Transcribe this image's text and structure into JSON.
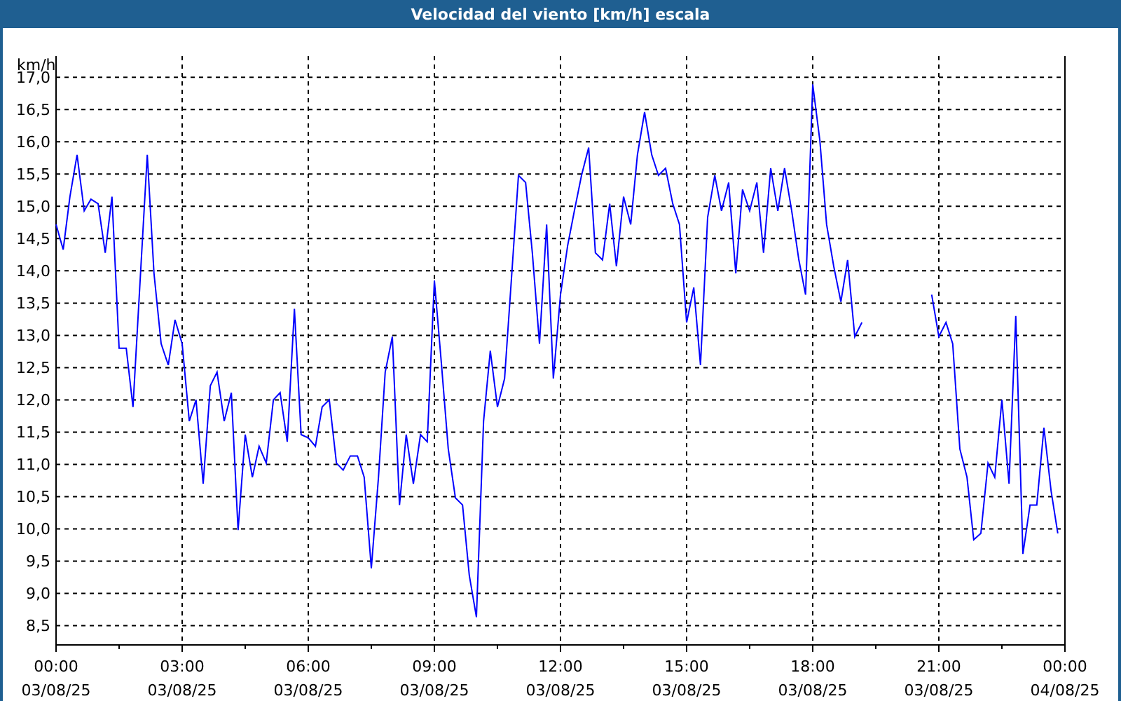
{
  "window": {
    "title": "Velocidad del viento [km/h] escala"
  },
  "chart": {
    "xtick_dates": [
      "03/08/25",
      "03/08/25",
      "03/08/25",
      "03/08/25",
      "03/08/25",
      "03/08/25",
      "03/08/25",
      "03/08/25",
      "04/08/25"
    ],
    "chart_data": {
      "type": "line",
      "ylabel": "km/h",
      "grid": true,
      "xlim": [
        0,
        24
      ],
      "ylim": [
        8.2,
        17.33
      ],
      "xticks": [
        {
          "value": 0,
          "label": "00:00"
        },
        {
          "value": 3,
          "label": "03:00"
        },
        {
          "value": 6,
          "label": "06:00"
        },
        {
          "value": 9,
          "label": "09:00"
        },
        {
          "value": 12,
          "label": "12:00"
        },
        {
          "value": 15,
          "label": "15:00"
        },
        {
          "value": 18,
          "label": "18:00"
        },
        {
          "value": 21,
          "label": "21:00"
        },
        {
          "value": 24,
          "label": "00:00"
        }
      ],
      "yticks": [
        {
          "value": 8.5,
          "label": "8,5"
        },
        {
          "value": 9,
          "label": "9,0"
        },
        {
          "value": 9.5,
          "label": "9,5"
        },
        {
          "value": 10,
          "label": "10,0"
        },
        {
          "value": 10.5,
          "label": "10,5"
        },
        {
          "value": 11,
          "label": "11,0"
        },
        {
          "value": 11.5,
          "label": "11,5"
        },
        {
          "value": 12,
          "label": "12,0"
        },
        {
          "value": 12.5,
          "label": "12,5"
        },
        {
          "value": 13,
          "label": "13,0"
        },
        {
          "value": 13.5,
          "label": "13,5"
        },
        {
          "value": 14,
          "label": "14,0"
        },
        {
          "value": 14.5,
          "label": "14,5"
        },
        {
          "value": 15,
          "label": "15,0"
        },
        {
          "value": 15.5,
          "label": "15,5"
        },
        {
          "value": 16,
          "label": "16,0"
        },
        {
          "value": 16.5,
          "label": "16,5"
        },
        {
          "value": 17,
          "label": "17,0"
        }
      ],
      "x": [
        0,
        0.17,
        0.33,
        0.5,
        0.67,
        0.83,
        1,
        1.17,
        1.33,
        1.5,
        1.67,
        1.83,
        2,
        2.17,
        2.33,
        2.5,
        2.67,
        2.83,
        3,
        3.17,
        3.33,
        3.5,
        3.67,
        3.83,
        4,
        4.17,
        4.33,
        4.5,
        4.67,
        4.83,
        5,
        5.17,
        5.33,
        5.5,
        5.67,
        5.83,
        6,
        6.17,
        6.33,
        6.5,
        6.67,
        6.83,
        7,
        7.17,
        7.33,
        7.5,
        7.67,
        7.83,
        8,
        8.17,
        8.33,
        8.5,
        8.67,
        8.83,
        9,
        9.17,
        9.33,
        9.5,
        9.67,
        9.83,
        10,
        10.17,
        10.33,
        10.5,
        10.67,
        10.83,
        11,
        11.17,
        11.33,
        11.5,
        11.67,
        11.83,
        12,
        12.17,
        12.33,
        12.5,
        12.67,
        12.83,
        13,
        13.17,
        13.33,
        13.5,
        13.67,
        13.83,
        14,
        14.17,
        14.33,
        14.5,
        14.67,
        14.83,
        15,
        15.17,
        15.33,
        15.5,
        15.67,
        15.83,
        16,
        16.17,
        16.33,
        16.5,
        16.67,
        16.83,
        17,
        17.17,
        17.33,
        17.5,
        17.67,
        17.83,
        18,
        18.17,
        18.33,
        18.5,
        18.67,
        18.83,
        19,
        19.17,
        19.33,
        19.5,
        19.67,
        19.83,
        20,
        20.17,
        20.33,
        20.5,
        20.67,
        20.83,
        21,
        21.17,
        21.33,
        21.5,
        21.67,
        21.83,
        22,
        22.17,
        22.33,
        22.5,
        22.67,
        22.83,
        23,
        23.17,
        23.33,
        23.5,
        23.67,
        23.83
      ],
      "series": [
        {
          "color": "#0000ff",
          "values": [
            14.72,
            14.33,
            15.15,
            15.8,
            14.93,
            15.11,
            15.04,
            14.28,
            15.15,
            12.8,
            12.8,
            11.89,
            13.85,
            15.8,
            13.96,
            12.87,
            12.54,
            13.24,
            12.87,
            11.67,
            12.0,
            10.7,
            12.22,
            12.43,
            11.67,
            12.11,
            9.98,
            11.46,
            10.8,
            11.28,
            11.02,
            12.0,
            12.11,
            11.35,
            13.41,
            11.46,
            11.41,
            11.28,
            11.89,
            12.0,
            11.02,
            10.91,
            11.13,
            11.13,
            10.8,
            9.39,
            10.8,
            12.43,
            12.98,
            10.37,
            11.46,
            10.7,
            11.46,
            11.35,
            13.85,
            12.54,
            11.24,
            10.48,
            10.37,
            9.28,
            8.63,
            11.67,
            12.76,
            11.89,
            12.33,
            13.85,
            15.48,
            15.37,
            14.28,
            12.87,
            14.72,
            12.33,
            13.63,
            14.39,
            14.93,
            15.48,
            15.91,
            14.28,
            14.17,
            15.04,
            14.07,
            15.15,
            14.72,
            15.8,
            16.46,
            15.8,
            15.48,
            15.59,
            15.04,
            14.72,
            13.2,
            13.74,
            12.54,
            14.83,
            15.48,
            14.93,
            15.37,
            13.96,
            15.26,
            14.93,
            15.37,
            14.28,
            15.59,
            14.93,
            15.59,
            14.93,
            14.17,
            13.63,
            16.89,
            16.02,
            14.72,
            14.07,
            13.52,
            14.17,
            12.98,
            13.2,
            null,
            null,
            null,
            null,
            null,
            null,
            null,
            null,
            null,
            13.63,
            12.98,
            13.2,
            12.87,
            11.24,
            10.8,
            9.83,
            9.93,
            11.02,
            10.8,
            12.0,
            10.7,
            13.3,
            9.61,
            10.37,
            10.37,
            11.57,
            10.59,
            9.93
          ]
        }
      ]
    }
  }
}
